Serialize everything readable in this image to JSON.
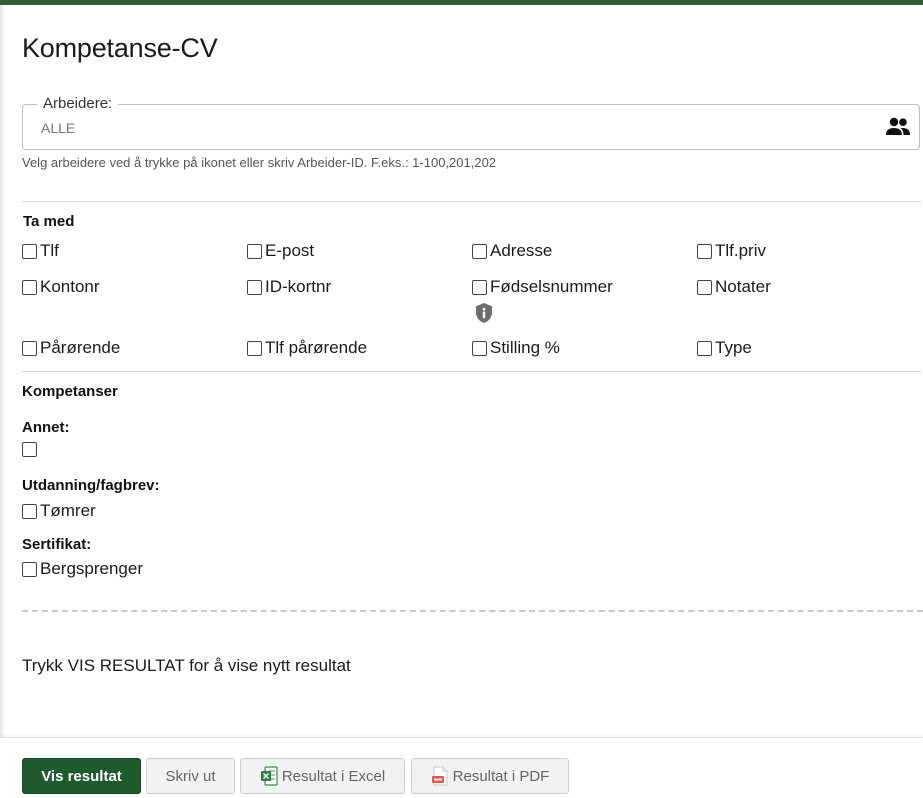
{
  "page": {
    "title": "Kompetanse-CV"
  },
  "workers": {
    "legend": "Arbeidere:",
    "value": "ALLE",
    "hint": "Velg arbeidere ved å trykke på ikonet eller skriv Arbeider-ID. F.eks.: 1-100,201,202",
    "icon": "people-icon"
  },
  "include": {
    "title": "Ta med",
    "options": [
      "Tlf",
      "E-post",
      "Adresse",
      "Tlf.priv",
      "Kontonr",
      "ID-kortnr",
      "Fødselsnummer",
      "Notater",
      "Pårørende",
      "Tlf pårørende",
      "Stilling %",
      "Type"
    ]
  },
  "competences": {
    "title": "Kompetanser",
    "groups": [
      {
        "label": "Annet:",
        "options": [
          ""
        ]
      },
      {
        "label": "Utdanning/fagbrev:",
        "options": [
          "Tømrer"
        ]
      },
      {
        "label": "Sertifikat:",
        "options": [
          "Bergsprenger"
        ]
      }
    ]
  },
  "message": "Trykk VIS RESULTAT for å vise nytt resultat",
  "footer": {
    "show_result": "Vis resultat",
    "print": "Skriv ut",
    "excel": "Resultat i Excel",
    "pdf": "Resultat i PDF"
  },
  "colors": {
    "brand": "#1f5a2e",
    "topbar": "#2e5e3a"
  }
}
